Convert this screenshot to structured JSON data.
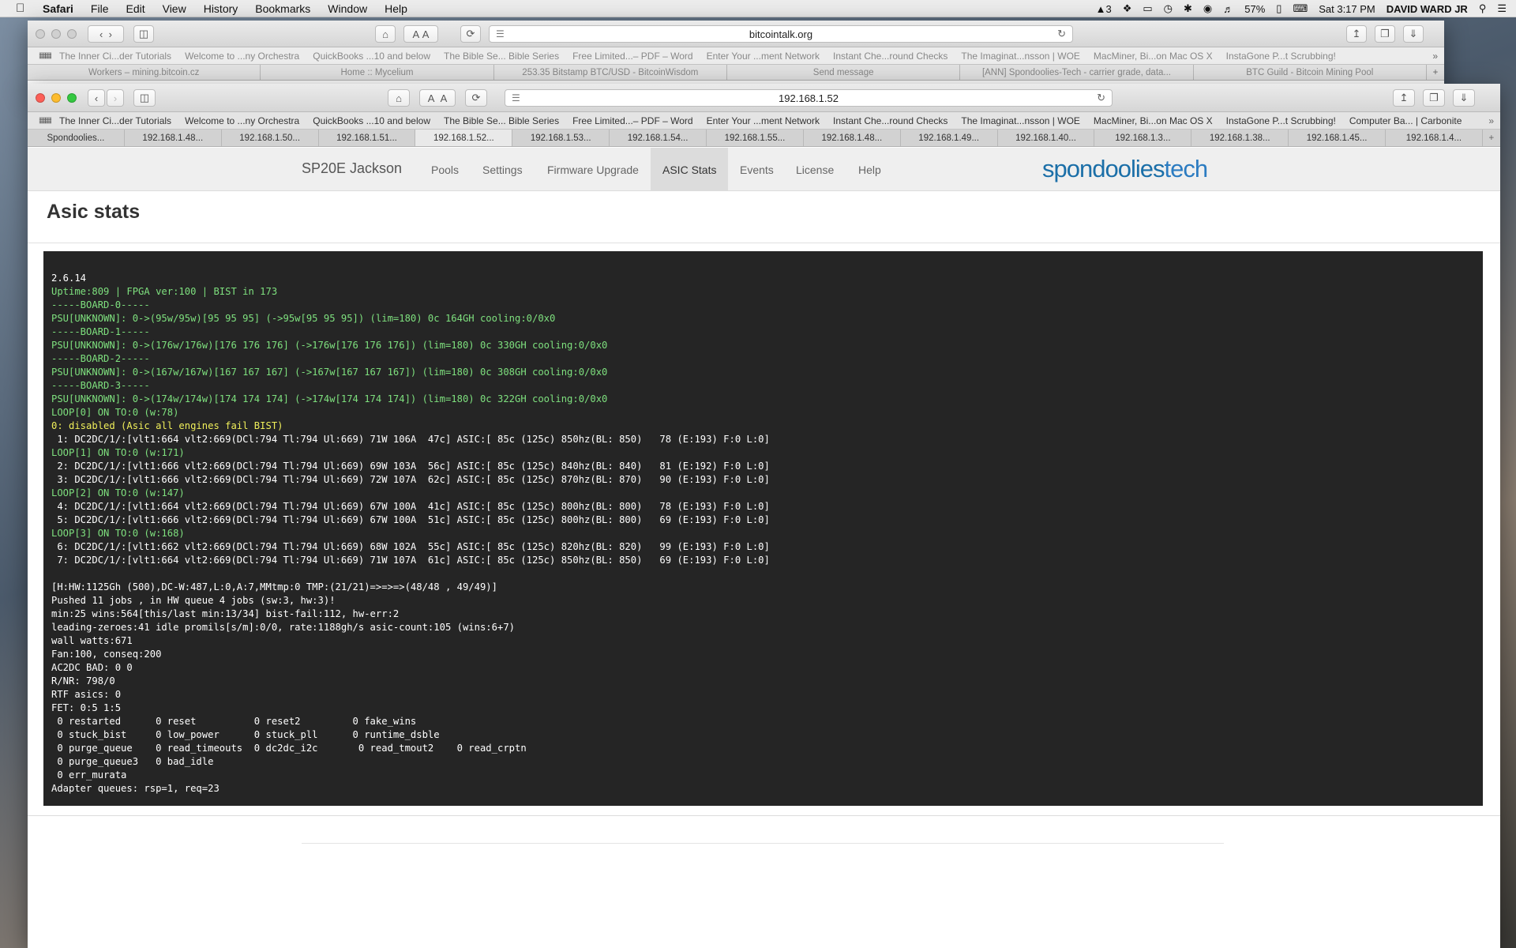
{
  "menubar": {
    "app": "Safari",
    "items": [
      "File",
      "Edit",
      "View",
      "History",
      "Bookmarks",
      "Window",
      "Help"
    ],
    "status": {
      "adobe": "3",
      "battery": "57%",
      "clock": "Sat 3:17 PM",
      "user": "DAVID WARD JR"
    }
  },
  "back_window": {
    "url": "bitcointalk.org",
    "favorites": [
      "The Inner Ci...der Tutorials",
      "Welcome to ...ny Orchestra",
      "QuickBooks ...10 and below",
      "The Bible Se... Bible Series",
      "Free Limited...– PDF – Word",
      "Enter Your ...ment Network",
      "Instant Che...round Checks",
      "The Imaginat...nsson | WOE",
      "MacMiner, Bi...on Mac OS X",
      "InstaGone P...t Scrubbing!"
    ],
    "tabs": [
      "Workers – mining.bitcoin.cz",
      "Home :: Mycelium",
      "253.35 Bitstamp BTC/USD - BitcoinWisdom",
      "Send message",
      "[ANN] Spondoolies-Tech - carrier grade, data...",
      "BTC Guild - Bitcoin Mining Pool"
    ]
  },
  "front_window": {
    "url": "192.168.1.52",
    "favorites": [
      "The Inner Ci...der Tutorials",
      "Welcome to ...ny Orchestra",
      "QuickBooks ...10 and below",
      "The Bible Se... Bible Series",
      "Free Limited...– PDF – Word",
      "Enter Your ...ment Network",
      "Instant Che...round Checks",
      "The Imaginat...nsson | WOE",
      "MacMiner, Bi...on Mac OS X",
      "InstaGone P...t Scrubbing!",
      "Computer Ba... | Carbonite"
    ],
    "tabs": [
      "Spondoolies...",
      "192.168.1.48...",
      "192.168.1.50...",
      "192.168.1.51...",
      "192.168.1.52...",
      "192.168.1.53...",
      "192.168.1.54...",
      "192.168.1.55...",
      "192.168.1.48...",
      "192.168.1.49...",
      "192.168.1.40...",
      "192.168.1.3...",
      "192.168.1.38...",
      "192.168.1.45...",
      "192.168.1.4..."
    ],
    "active_tab": 4
  },
  "nav": {
    "brand": "SP20E Jackson",
    "items": [
      "Pools",
      "Settings",
      "Firmware Upgrade",
      "ASIC Stats",
      "Events",
      "License",
      "Help"
    ],
    "active": "ASIC Stats",
    "logo_a": "spondoolies",
    "logo_b": "tech"
  },
  "page": {
    "title": "Asic stats"
  },
  "console": {
    "lines": [
      {
        "c": "white",
        "t": "2.6.14"
      },
      {
        "c": "green",
        "t": "Uptime:809 | FPGA ver:100 | BIST in 173"
      },
      {
        "c": "green",
        "t": "-----BOARD-0-----"
      },
      {
        "c": "green",
        "t": "PSU[UNKNOWN]: 0->(95w/95w)[95 95 95] (->95w[95 95 95]) (lim=180) 0c 164GH cooling:0/0x0"
      },
      {
        "c": "green",
        "t": "-----BOARD-1-----"
      },
      {
        "c": "green",
        "t": "PSU[UNKNOWN]: 0->(176w/176w)[176 176 176] (->176w[176 176 176]) (lim=180) 0c 330GH cooling:0/0x0"
      },
      {
        "c": "green",
        "t": "-----BOARD-2-----"
      },
      {
        "c": "green",
        "t": "PSU[UNKNOWN]: 0->(167w/167w)[167 167 167] (->167w[167 167 167]) (lim=180) 0c 308GH cooling:0/0x0"
      },
      {
        "c": "green",
        "t": "-----BOARD-3-----"
      },
      {
        "c": "green",
        "t": "PSU[UNKNOWN]: 0->(174w/174w)[174 174 174] (->174w[174 174 174]) (lim=180) 0c 322GH cooling:0/0x0"
      },
      {
        "c": "green",
        "t": "LOOP[0] ON TO:0 (w:78)"
      },
      {
        "c": "yellow",
        "t": "0: disabled (Asic all engines fail BIST)"
      },
      {
        "c": "white",
        "t": " 1: DC2DC/1/:[vlt1:664 vlt2:669(DCl:794 Tl:794 Ul:669) 71W 106A  47c] ASIC:[ 85c (125c) 850hz(BL: 850)   78 (E:193) F:0 L:0]"
      },
      {
        "c": "green",
        "t": "LOOP[1] ON TO:0 (w:171)"
      },
      {
        "c": "white",
        "t": " 2: DC2DC/1/:[vlt1:666 vlt2:669(DCl:794 Tl:794 Ul:669) 69W 103A  56c] ASIC:[ 85c (125c) 840hz(BL: 840)   81 (E:192) F:0 L:0]"
      },
      {
        "c": "white",
        "t": " 3: DC2DC/1/:[vlt1:666 vlt2:669(DCl:794 Tl:794 Ul:669) 72W 107A  62c] ASIC:[ 85c (125c) 870hz(BL: 870)   90 (E:193) F:0 L:0]"
      },
      {
        "c": "green",
        "t": "LOOP[2] ON TO:0 (w:147)"
      },
      {
        "c": "white",
        "t": " 4: DC2DC/1/:[vlt1:664 vlt2:669(DCl:794 Tl:794 Ul:669) 67W 100A  41c] ASIC:[ 85c (125c) 800hz(BL: 800)   78 (E:193) F:0 L:0]"
      },
      {
        "c": "white",
        "t": " 5: DC2DC/1/:[vlt1:666 vlt2:669(DCl:794 Tl:794 Ul:669) 67W 100A  51c] ASIC:[ 85c (125c) 800hz(BL: 800)   69 (E:193) F:0 L:0]"
      },
      {
        "c": "green",
        "t": "LOOP[3] ON TO:0 (w:168)"
      },
      {
        "c": "white",
        "t": " 6: DC2DC/1/:[vlt1:662 vlt2:669(DCl:794 Tl:794 Ul:669) 68W 102A  55c] ASIC:[ 85c (125c) 820hz(BL: 820)   99 (E:193) F:0 L:0]"
      },
      {
        "c": "white",
        "t": " 7: DC2DC/1/:[vlt1:664 vlt2:669(DCl:794 Tl:794 Ul:669) 71W 107A  61c] ASIC:[ 85c (125c) 850hz(BL: 850)   69 (E:193) F:0 L:0]"
      },
      {
        "c": "white",
        "t": ""
      },
      {
        "c": "white",
        "t": "[H:HW:1125Gh (500),DC-W:487,L:0,A:7,MMtmp:0 TMP:(21/21)=>=>=>(48/48 , 49/49)]"
      },
      {
        "c": "white",
        "t": "Pushed 11 jobs , in HW queue 4 jobs (sw:3, hw:3)!"
      },
      {
        "c": "white",
        "t": "min:25 wins:564[this/last min:13/34] bist-fail:112, hw-err:2"
      },
      {
        "c": "white",
        "t": "leading-zeroes:41 idle promils[s/m]:0/0, rate:1188gh/s asic-count:105 (wins:6+7)"
      },
      {
        "c": "white",
        "t": "wall watts:671"
      },
      {
        "c": "white",
        "t": "Fan:100, conseq:200"
      },
      {
        "c": "white",
        "t": "AC2DC BAD: 0 0"
      },
      {
        "c": "white",
        "t": "R/NR: 798/0"
      },
      {
        "c": "white",
        "t": "RTF asics: 0"
      },
      {
        "c": "white",
        "t": "FET: 0:5 1:5"
      },
      {
        "c": "white",
        "t": " 0 restarted      0 reset          0 reset2         0 fake_wins"
      },
      {
        "c": "white",
        "t": " 0 stuck_bist     0 low_power      0 stuck_pll      0 runtime_dsble"
      },
      {
        "c": "white",
        "t": " 0 purge_queue    0 read_timeouts  0 dc2dc_i2c       0 read_tmout2    0 read_crptn"
      },
      {
        "c": "white",
        "t": " 0 purge_queue3   0 bad_idle"
      },
      {
        "c": "white",
        "t": " 0 err_murata"
      },
      {
        "c": "white",
        "t": "Adapter queues: rsp=1, req=23"
      }
    ]
  },
  "colors": {
    "console_bg": "#252525",
    "green": "#7ee07e",
    "yellow": "#f0ef5a",
    "logo_blue": "#1b6fa8"
  }
}
